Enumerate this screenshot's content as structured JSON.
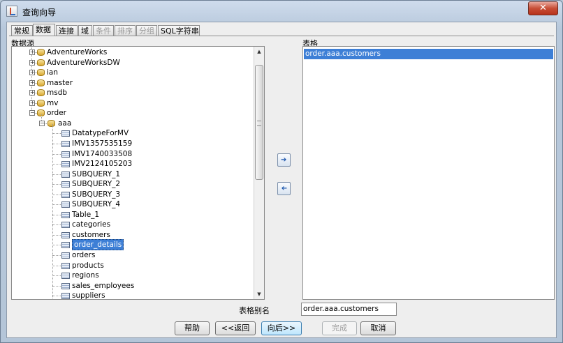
{
  "window": {
    "title": "查询向导"
  },
  "tabs": [
    {
      "label": "常规",
      "disabled": false
    },
    {
      "label": "数据",
      "disabled": false,
      "active": true
    },
    {
      "label": "连接",
      "disabled": false
    },
    {
      "label": "域",
      "disabled": false
    },
    {
      "label": "条件",
      "disabled": true
    },
    {
      "label": "排序",
      "disabled": true
    },
    {
      "label": "分组",
      "disabled": true
    },
    {
      "label": "SQL字符串",
      "disabled": false
    }
  ],
  "datasource": {
    "label": "数据源",
    "databases": [
      "AdventureWorks",
      "AdventureWorksDW",
      "ian",
      "master",
      "msdb",
      "mv",
      "order"
    ],
    "schema": "aaa",
    "tables": [
      "DatatypeForMV",
      "IMV1357535159",
      "IMV1740033508",
      "IMV2124105203",
      "SUBQUERY_1",
      "SUBQUERY_2",
      "SUBQUERY_3",
      "SUBQUERY_4",
      "Table_1",
      "categories",
      "customers",
      "order_details",
      "orders",
      "products",
      "regions",
      "sales_employees",
      "suppliers"
    ],
    "selected_table": "order_details"
  },
  "tables_panel": {
    "label": "表格",
    "items": [
      "order.aaa.customers"
    ]
  },
  "alias": {
    "label": "表格别名",
    "value": "order.aaa.customers"
  },
  "buttons": {
    "help": "帮助",
    "back": "<<返回",
    "next": "向后>>",
    "finish": "完成",
    "cancel": "取消"
  }
}
